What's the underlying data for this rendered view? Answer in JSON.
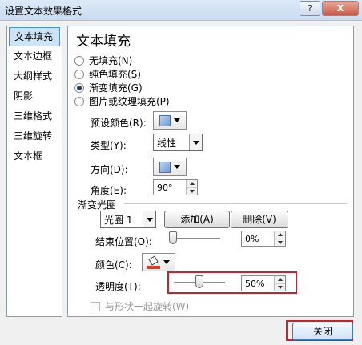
{
  "window": {
    "title": "设置文本效果格式",
    "help_label": "?",
    "close_glyph": "X"
  },
  "sidebar": {
    "items": [
      {
        "label": "文本填充",
        "selected": true
      },
      {
        "label": "文本边框"
      },
      {
        "label": "大纲样式"
      },
      {
        "label": "阴影"
      },
      {
        "label": "三维格式"
      },
      {
        "label": "三维旋转"
      },
      {
        "label": "文本框"
      }
    ]
  },
  "panel": {
    "heading": "文本填充",
    "fill_options": [
      {
        "label": "无填充(N)",
        "selected": false
      },
      {
        "label": "纯色填充(S)",
        "selected": false
      },
      {
        "label": "渐变填充(G)",
        "selected": true
      },
      {
        "label": "图片或纹理填充(P)",
        "selected": false
      }
    ],
    "preset_color_label": "预设颜色(R):",
    "type_label": "类型(Y):",
    "type_value": "线性",
    "direction_label": "方向(D):",
    "angle_label": "角度(E):",
    "angle_value": "90°",
    "gradient_stops_label": "渐变光圈",
    "stop_select_value": "光圈 1",
    "add_label": "添加(A)",
    "delete_label": "删除(V)",
    "end_position_label": "结束位置(O):",
    "end_position_value": "0%",
    "color_label": "颜色(C):",
    "transparency_label": "透明度(T):",
    "transparency_value": "50%",
    "end_position_fraction": 0.0,
    "transparency_fraction": 0.5,
    "rotate_with_shape_label": "与形状一起旋转(W)"
  },
  "footer": {
    "close_label": "关闭"
  },
  "colors": {
    "accent_highlight": "#c8232b",
    "paint_bucket_color": "#e23a2a",
    "selected_sidebar_bg": "#cce4f7"
  }
}
